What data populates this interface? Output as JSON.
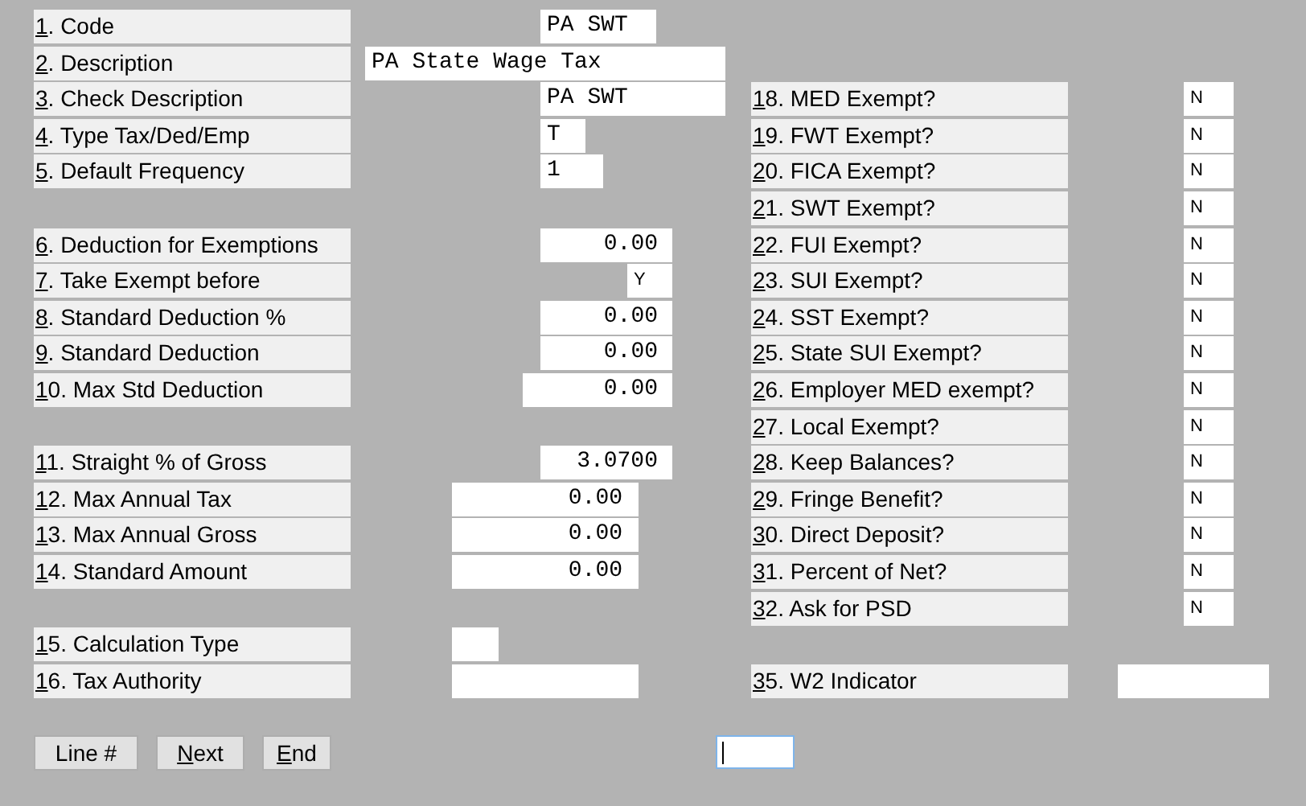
{
  "left_groups": [
    [
      {
        "label": "1. Code",
        "kind": "text",
        "value": "PA SWT"
      },
      {
        "label": "2. Description",
        "kind": "text",
        "value": "PA State Wage Tax"
      },
      {
        "label": "3. Check Description",
        "kind": "text",
        "value": "PA SWT"
      },
      {
        "label": "4. Type Tax/Ded/Emp",
        "kind": "text",
        "value": "T"
      },
      {
        "label": "5. Default Frequency",
        "kind": "text",
        "value": "1"
      }
    ],
    [
      {
        "label": "6. Deduction for Exemptions",
        "kind": "numeric",
        "value": "0.00"
      },
      {
        "label": "7. Take Exempt before",
        "kind": "flag",
        "value": "Y"
      },
      {
        "label": "8. Standard Deduction %",
        "kind": "numeric",
        "value": "0.00"
      },
      {
        "label": "9. Standard Deduction",
        "kind": "numeric",
        "value": "0.00"
      },
      {
        "label": "10. Max Std Deduction",
        "kind": "numeric",
        "value": "0.00"
      }
    ],
    [
      {
        "label": "11. Straight % of Gross",
        "kind": "numeric",
        "value": "3.0700"
      },
      {
        "label": "12. Max Annual Tax",
        "kind": "numeric",
        "value": "0.00"
      },
      {
        "label": "13. Max Annual Gross",
        "kind": "numeric",
        "value": "0.00"
      },
      {
        "label": "14. Standard Amount",
        "kind": "numeric",
        "value": "0.00"
      }
    ],
    [
      {
        "label": "15. Calculation Type",
        "kind": "text"
      },
      {
        "label": "16. Tax Authority",
        "kind": "text"
      }
    ]
  ],
  "right_groups": [
    [
      {
        "label": "18. MED Exempt?",
        "kind": "flag",
        "value": "N"
      },
      {
        "label": "19. FWT Exempt?",
        "kind": "flag",
        "value": "N"
      },
      {
        "label": "20. FICA Exempt?",
        "kind": "flag",
        "value": "N"
      },
      {
        "label": "21. SWT Exempt?",
        "kind": "flag",
        "value": "N"
      },
      {
        "label": "22. FUI Exempt?",
        "kind": "flag",
        "value": "N"
      },
      {
        "label": "23. SUI Exempt?",
        "kind": "flag",
        "value": "N"
      },
      {
        "label": "24. SST Exempt?",
        "kind": "flag",
        "value": "N"
      },
      {
        "label": "25. State SUI Exempt?",
        "kind": "flag",
        "value": "N"
      },
      {
        "label": "26. Employer MED exempt?",
        "kind": "flag",
        "value": "N"
      },
      {
        "label": "27. Local Exempt?",
        "kind": "flag",
        "value": "N"
      },
      {
        "label": "28. Keep Balances?",
        "kind": "flag",
        "value": "N"
      },
      {
        "label": "29. Fringe Benefit?",
        "kind": "flag",
        "value": "N"
      },
      {
        "label": "30. Direct Deposit?",
        "kind": "flag",
        "value": "N"
      },
      {
        "label": "31. Percent of Net?",
        "kind": "flag",
        "value": "N"
      },
      {
        "label": "32. Ask for PSD",
        "kind": "flag",
        "value": "N"
      }
    ],
    [
      {
        "label": "35. W2 Indicator",
        "kind": "text"
      }
    ]
  ],
  "buttons": [
    {
      "label": "Line #",
      "underline_first": false
    },
    {
      "label": "Next",
      "underline_first": true
    },
    {
      "label": "End",
      "underline_first": true
    }
  ],
  "command_field": {
    "focused": true
  }
}
